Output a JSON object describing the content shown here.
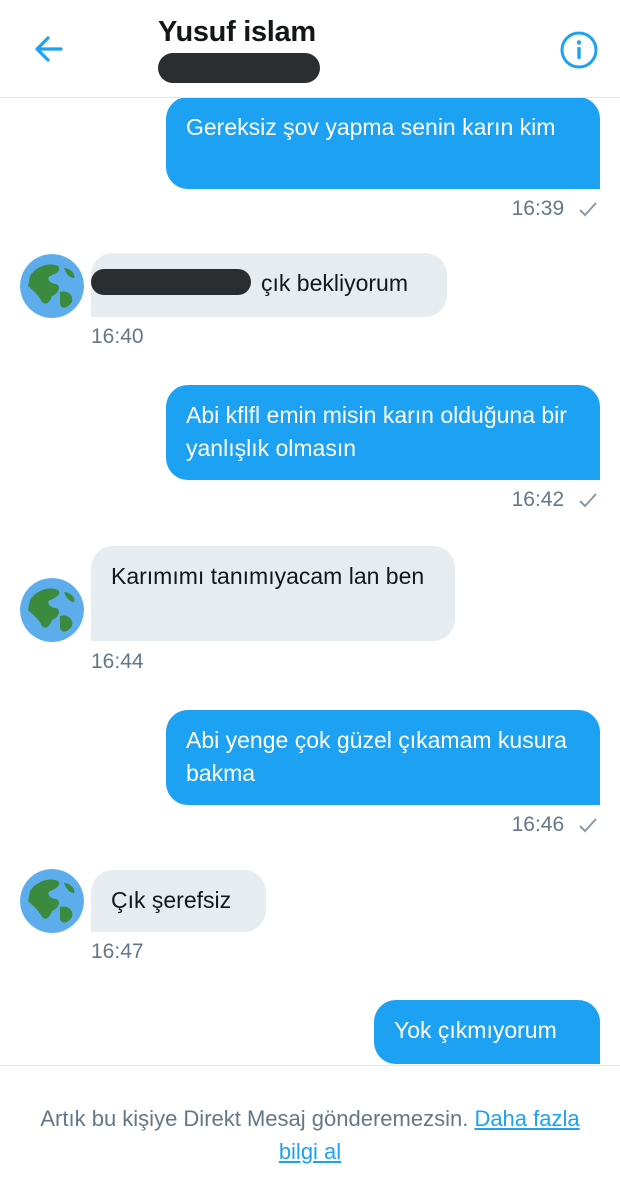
{
  "header": {
    "title": "Yusuf islam",
    "back_icon": "back-arrow-icon",
    "info_icon": "info-icon",
    "accent_color": "#1da1f2"
  },
  "messages": [
    {
      "direction": "out",
      "text": "Gereksiz şov yapma senin karın kim",
      "time": "16:39",
      "status_icon": "checkmark-icon"
    },
    {
      "direction": "in",
      "text": "çık bekliyorum",
      "time": "16:40",
      "has_redaction": true
    },
    {
      "direction": "out",
      "text": "Abi kflfl emin misin karın olduğuna bir yanlışlık olmasın",
      "time": "16:42",
      "status_icon": "checkmark-icon"
    },
    {
      "direction": "in",
      "text": "Karımımı tanımıyacam lan ben",
      "time": "16:44"
    },
    {
      "direction": "out",
      "text": "Abi yenge çok güzel çıkamam kusura bakma",
      "time": "16:46",
      "status_icon": "checkmark-icon"
    },
    {
      "direction": "in",
      "text": "Çık şerefsiz",
      "time": "16:47"
    },
    {
      "direction": "out",
      "text": "Yok çıkmıyorum"
    }
  ],
  "footer": {
    "notice_text": "Artık bu kişiye Direkt Mesaj gönderemezsin.",
    "link_text": "Daha fazla bilgi al"
  },
  "colors": {
    "outgoing_bubble": "#1da1f2",
    "incoming_bubble": "#e6ecf0",
    "meta_text": "#657786"
  }
}
